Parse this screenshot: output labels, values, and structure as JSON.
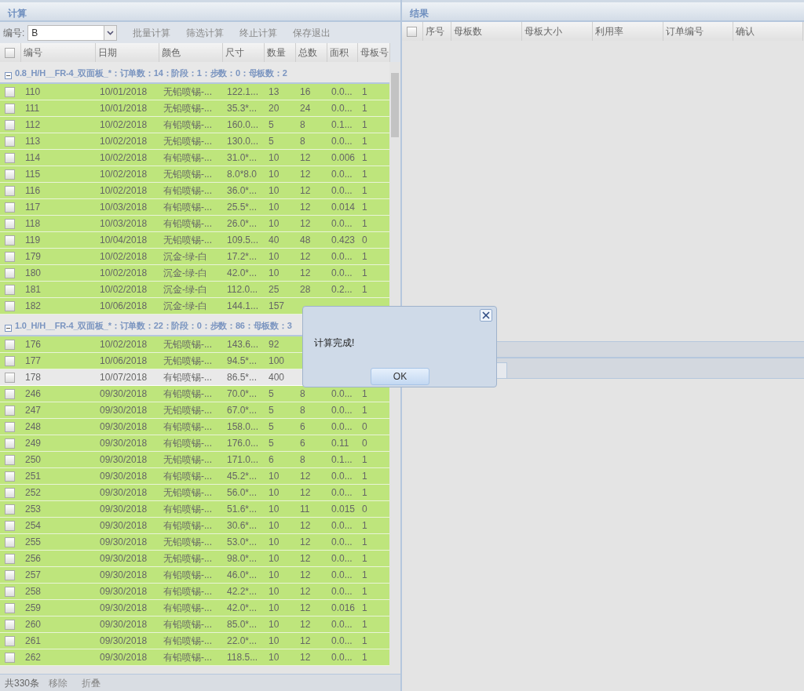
{
  "left_panel": {
    "title": "计算",
    "toolbar": {
      "label": "编号:",
      "select_value": "B",
      "buttons": [
        "批量计算",
        "筛选计算",
        "终止计算",
        "保存退出"
      ]
    },
    "header_checked": false,
    "columns": [
      "编号",
      "日期",
      "颜色",
      "尺寸",
      "数量",
      "总数",
      "面积",
      "母板号"
    ],
    "groups": [
      {
        "title": "0.8_H/H__FR-4_双面板_*：订单数：14：阶段：1：步数：0：母板数：2",
        "expanded": true,
        "rows": [
          {
            "checked": false,
            "selected": false,
            "cells": [
              "110",
              "10/01/2018",
              "无铅喷锡-...",
              "122.1...",
              "13",
              "16",
              "0.0...",
              "1"
            ]
          },
          {
            "checked": false,
            "selected": false,
            "cells": [
              "111",
              "10/01/2018",
              "无铅喷锡-...",
              "35.3*...",
              "20",
              "24",
              "0.0...",
              "1"
            ]
          },
          {
            "checked": false,
            "selected": false,
            "cells": [
              "112",
              "10/02/2018",
              "有铅喷锡-...",
              "160.0...",
              "5",
              "8",
              "0.1...",
              "1"
            ]
          },
          {
            "checked": false,
            "selected": false,
            "cells": [
              "113",
              "10/02/2018",
              "无铅喷锡-...",
              "130.0...",
              "5",
              "8",
              "0.0...",
              "1"
            ]
          },
          {
            "checked": false,
            "selected": false,
            "cells": [
              "114",
              "10/02/2018",
              "有铅喷锡-...",
              "31.0*...",
              "10",
              "12",
              "0.006",
              "1"
            ]
          },
          {
            "checked": false,
            "selected": false,
            "cells": [
              "115",
              "10/02/2018",
              "无铅喷锡-...",
              "8.0*8.0",
              "10",
              "12",
              "0.0...",
              "1"
            ]
          },
          {
            "checked": false,
            "selected": false,
            "cells": [
              "116",
              "10/02/2018",
              "有铅喷锡-...",
              "36.0*...",
              "10",
              "12",
              "0.0...",
              "1"
            ]
          },
          {
            "checked": false,
            "selected": false,
            "cells": [
              "117",
              "10/03/2018",
              "有铅喷锡-...",
              "25.5*...",
              "10",
              "12",
              "0.014",
              "1"
            ]
          },
          {
            "checked": false,
            "selected": false,
            "cells": [
              "118",
              "10/03/2018",
              "有铅喷锡-...",
              "26.0*...",
              "10",
              "12",
              "0.0...",
              "1"
            ]
          },
          {
            "checked": false,
            "selected": false,
            "cells": [
              "119",
              "10/04/2018",
              "无铅喷锡-...",
              "109.5...",
              "40",
              "48",
              "0.423",
              "0"
            ]
          },
          {
            "checked": false,
            "selected": false,
            "cells": [
              "179",
              "10/02/2018",
              "沉金-绿-白",
              "17.2*...",
              "10",
              "12",
              "0.0...",
              "1"
            ]
          },
          {
            "checked": false,
            "selected": false,
            "cells": [
              "180",
              "10/02/2018",
              "沉金-绿-白",
              "42.0*...",
              "10",
              "12",
              "0.0...",
              "1"
            ]
          },
          {
            "checked": false,
            "selected": false,
            "cells": [
              "181",
              "10/02/2018",
              "沉金-绿-白",
              "112.0...",
              "25",
              "28",
              "0.2...",
              "1"
            ]
          },
          {
            "checked": false,
            "selected": false,
            "cells": [
              "182",
              "10/06/2018",
              "沉金-绿-白",
              "144.1...",
              "157"
            ]
          }
        ]
      },
      {
        "title": "1.0_H/H__FR-4_双面板_*：订单数：22：阶段：0：步数：86：母板数：3",
        "expanded": true,
        "rows": [
          {
            "checked": false,
            "selected": false,
            "cells": [
              "176",
              "10/02/2018",
              "无铅喷锡-...",
              "143.6...",
              "92"
            ]
          },
          {
            "checked": false,
            "selected": false,
            "cells": [
              "177",
              "10/06/2018",
              "无铅喷锡-...",
              "94.5*...",
              "100"
            ]
          },
          {
            "checked": false,
            "selected": true,
            "cells": [
              "178",
              "10/07/2018",
              "有铅喷锡-...",
              "86.5*...",
              "400"
            ]
          },
          {
            "checked": false,
            "selected": false,
            "cells": [
              "246",
              "09/30/2018",
              "有铅喷锡-...",
              "70.0*...",
              "5",
              "8",
              "0.0...",
              "1"
            ]
          },
          {
            "checked": false,
            "selected": false,
            "cells": [
              "247",
              "09/30/2018",
              "无铅喷锡-...",
              "67.0*...",
              "5",
              "8",
              "0.0...",
              "1"
            ]
          },
          {
            "checked": false,
            "selected": false,
            "cells": [
              "248",
              "09/30/2018",
              "有铅喷锡-...",
              "158.0...",
              "5",
              "6",
              "0.0...",
              "0"
            ]
          },
          {
            "checked": false,
            "selected": false,
            "cells": [
              "249",
              "09/30/2018",
              "有铅喷锡-...",
              "176.0...",
              "5",
              "6",
              "0.11",
              "0"
            ]
          },
          {
            "checked": false,
            "selected": false,
            "cells": [
              "250",
              "09/30/2018",
              "无铅喷锡-...",
              "171.0...",
              "6",
              "8",
              "0.1...",
              "1"
            ]
          },
          {
            "checked": false,
            "selected": false,
            "cells": [
              "251",
              "09/30/2018",
              "有铅喷锡-...",
              "45.2*...",
              "10",
              "12",
              "0.0...",
              "1"
            ]
          },
          {
            "checked": false,
            "selected": false,
            "cells": [
              "252",
              "09/30/2018",
              "无铅喷锡-...",
              "56.0*...",
              "10",
              "12",
              "0.0...",
              "1"
            ]
          },
          {
            "checked": false,
            "selected": false,
            "cells": [
              "253",
              "09/30/2018",
              "有铅喷锡-...",
              "51.6*...",
              "10",
              "11",
              "0.015",
              "0"
            ]
          },
          {
            "checked": false,
            "selected": false,
            "cells": [
              "254",
              "09/30/2018",
              "有铅喷锡-...",
              "30.6*...",
              "10",
              "12",
              "0.0...",
              "1"
            ]
          },
          {
            "checked": false,
            "selected": false,
            "cells": [
              "255",
              "09/30/2018",
              "无铅喷锡-...",
              "53.0*...",
              "10",
              "12",
              "0.0...",
              "1"
            ]
          },
          {
            "checked": false,
            "selected": false,
            "cells": [
              "256",
              "09/30/2018",
              "无铅喷锡-...",
              "98.0*...",
              "10",
              "12",
              "0.0...",
              "1"
            ]
          },
          {
            "checked": false,
            "selected": false,
            "cells": [
              "257",
              "09/30/2018",
              "有铅喷锡-...",
              "46.0*...",
              "10",
              "12",
              "0.0...",
              "1"
            ]
          },
          {
            "checked": false,
            "selected": false,
            "cells": [
              "258",
              "09/30/2018",
              "有铅喷锡-...",
              "42.2*...",
              "10",
              "12",
              "0.0...",
              "1"
            ]
          },
          {
            "checked": false,
            "selected": false,
            "cells": [
              "259",
              "09/30/2018",
              "有铅喷锡-...",
              "42.0*...",
              "10",
              "12",
              "0.016",
              "1"
            ]
          },
          {
            "checked": false,
            "selected": false,
            "cells": [
              "260",
              "09/30/2018",
              "有铅喷锡-...",
              "85.0*...",
              "10",
              "12",
              "0.0...",
              "1"
            ]
          },
          {
            "checked": false,
            "selected": false,
            "cells": [
              "261",
              "09/30/2018",
              "有铅喷锡-...",
              "22.0*...",
              "10",
              "12",
              "0.0...",
              "1"
            ]
          },
          {
            "checked": false,
            "selected": false,
            "cells": [
              "262",
              "09/30/2018",
              "有铅喷锡-...",
              "118.5...",
              "10",
              "12",
              "0.0...",
              "1"
            ]
          }
        ]
      }
    ],
    "status_bar": {
      "count": "共330条",
      "buttons": [
        "移除",
        "折叠"
      ]
    }
  },
  "right_panel": {
    "title": "结果",
    "header_checked": false,
    "columns": [
      "序号",
      "母板数",
      "母板大小",
      "利用率",
      "订单编号",
      "确认"
    ]
  },
  "dialog": {
    "message": "计算完成!",
    "button": "OK"
  }
}
